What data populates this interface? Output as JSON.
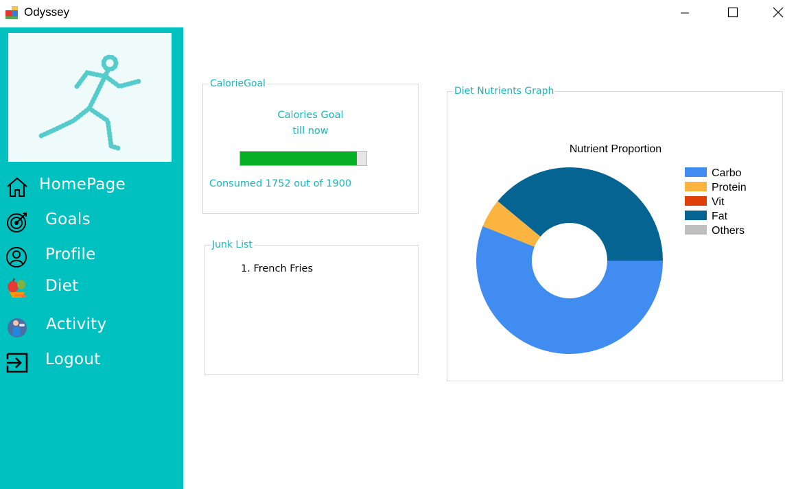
{
  "window": {
    "title": "Odyssey",
    "controls": {
      "minimize": "minimize-icon",
      "maximize": "maximize-icon",
      "close": "close-icon"
    }
  },
  "sidebar": {
    "background": "#00c0c0",
    "logo": "runner-logo",
    "items": [
      {
        "label": "HomePage",
        "icon": "home-icon"
      },
      {
        "label": "Goals",
        "icon": "target-icon"
      },
      {
        "label": "Profile",
        "icon": "user-icon"
      },
      {
        "label": "Diet",
        "icon": "food-icon"
      },
      {
        "label": "Activity",
        "icon": "activity-icon"
      },
      {
        "label": "Logout",
        "icon": "logout-icon"
      }
    ]
  },
  "calorie_goal": {
    "group_title": "CalorieGoal",
    "caption_line1": "Calories Goal",
    "caption_line2": "till now",
    "consumed_text": "Consumed 1752 out of 1900",
    "consumed": 1752,
    "goal": 1900,
    "bar_color": "#06b025"
  },
  "junk_list": {
    "group_title": "Junk List",
    "items": [
      "1. French Fries"
    ]
  },
  "diet_graph": {
    "group_title": "Diet Nutrients Graph"
  },
  "chart_data": {
    "type": "pie",
    "donut": true,
    "title": "Nutrient Proportion",
    "legend_position": "right",
    "categories": [
      "Carbo",
      "Protein",
      "Vit",
      "Fat",
      "Others"
    ],
    "values": [
      56,
      5,
      0,
      39,
      0
    ],
    "colors": [
      "#418cf0",
      "#fcb441",
      "#e0400a",
      "#056492",
      "#bfbfbf"
    ]
  }
}
